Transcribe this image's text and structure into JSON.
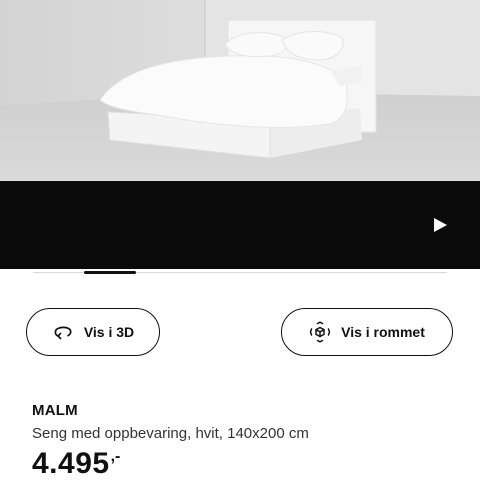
{
  "media": {
    "image_icon": "bed-product-image",
    "play_icon": "play-icon",
    "carousel": {
      "active_index": 0
    }
  },
  "actions": {
    "view_3d": {
      "label": "Vis i 3D",
      "icon": "rotate-3d-icon"
    },
    "view_room": {
      "label": "Vis i rommet",
      "icon": "ar-cube-icon"
    }
  },
  "product": {
    "name": "MALM",
    "description": "Seng med oppbevaring, hvit, 140x200 cm",
    "price": "4.495",
    "price_suffix": ",-"
  },
  "colors": {
    "video_background": "#0b0b0b",
    "text": "#111111",
    "accent_indicator": "#111111"
  }
}
